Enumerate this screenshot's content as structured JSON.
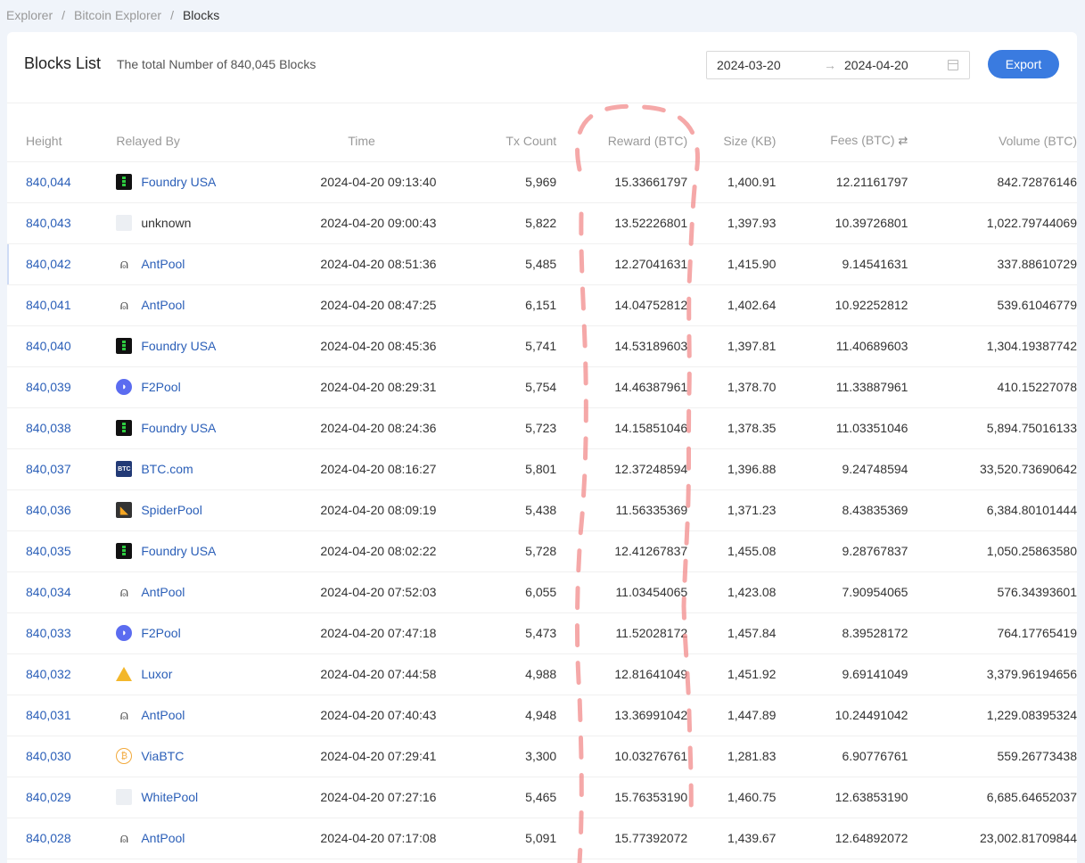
{
  "breadcrumb": [
    "Explorer",
    "Bitcoin Explorer",
    "Blocks"
  ],
  "title": "Blocks List",
  "subtitle": "The total Number of 840,045 Blocks",
  "date_range": {
    "start": "2024-03-20",
    "end": "2024-04-20"
  },
  "export_label": "Export",
  "columns": [
    "Height",
    "Relayed By",
    "Time",
    "Tx Count",
    "Reward (BTC)",
    "Size (KB)",
    "Fees (BTC)",
    "Volume (BTC)"
  ],
  "rows": [
    {
      "height": "840,044",
      "relay": "Foundry USA",
      "icon": "foundry-icon",
      "linked": true,
      "time": "2024-04-20 09:13:40",
      "tx": "5,969",
      "reward": "15.33661797",
      "size": "1,400.91",
      "fees": "12.21161797",
      "volume": "842.72876146"
    },
    {
      "height": "840,043",
      "relay": "unknown",
      "icon": "unknown-pool-icon",
      "linked": false,
      "time": "2024-04-20 09:00:43",
      "tx": "5,822",
      "reward": "13.52226801",
      "size": "1,397.93",
      "fees": "10.39726801",
      "volume": "1,022.79744069"
    },
    {
      "height": "840,042",
      "relay": "AntPool",
      "icon": "antpool-icon",
      "linked": true,
      "time": "2024-04-20 08:51:36",
      "tx": "5,485",
      "reward": "12.27041631",
      "size": "1,415.90",
      "fees": "9.14541631",
      "volume": "337.88610729"
    },
    {
      "height": "840,041",
      "relay": "AntPool",
      "icon": "antpool-icon",
      "linked": true,
      "time": "2024-04-20 08:47:25",
      "tx": "6,151",
      "reward": "14.04752812",
      "size": "1,402.64",
      "fees": "10.92252812",
      "volume": "539.61046779"
    },
    {
      "height": "840,040",
      "relay": "Foundry USA",
      "icon": "foundry-icon",
      "linked": true,
      "time": "2024-04-20 08:45:36",
      "tx": "5,741",
      "reward": "14.53189603",
      "size": "1,397.81",
      "fees": "11.40689603",
      "volume": "1,304.19387742"
    },
    {
      "height": "840,039",
      "relay": "F2Pool",
      "icon": "f2pool-icon",
      "linked": true,
      "time": "2024-04-20 08:29:31",
      "tx": "5,754",
      "reward": "14.46387961",
      "size": "1,378.70",
      "fees": "11.33887961",
      "volume": "410.15227078"
    },
    {
      "height": "840,038",
      "relay": "Foundry USA",
      "icon": "foundry-icon",
      "linked": true,
      "time": "2024-04-20 08:24:36",
      "tx": "5,723",
      "reward": "14.15851046",
      "size": "1,378.35",
      "fees": "11.03351046",
      "volume": "5,894.75016133"
    },
    {
      "height": "840,037",
      "relay": "BTC.com",
      "icon": "btccom-icon",
      "linked": true,
      "time": "2024-04-20 08:16:27",
      "tx": "5,801",
      "reward": "12.37248594",
      "size": "1,396.88",
      "fees": "9.24748594",
      "volume": "33,520.73690642"
    },
    {
      "height": "840,036",
      "relay": "SpiderPool",
      "icon": "spiderpool-icon",
      "linked": true,
      "time": "2024-04-20 08:09:19",
      "tx": "5,438",
      "reward": "11.56335369",
      "size": "1,371.23",
      "fees": "8.43835369",
      "volume": "6,384.80101444"
    },
    {
      "height": "840,035",
      "relay": "Foundry USA",
      "icon": "foundry-icon",
      "linked": true,
      "time": "2024-04-20 08:02:22",
      "tx": "5,728",
      "reward": "12.41267837",
      "size": "1,455.08",
      "fees": "9.28767837",
      "volume": "1,050.25863580"
    },
    {
      "height": "840,034",
      "relay": "AntPool",
      "icon": "antpool-icon",
      "linked": true,
      "time": "2024-04-20 07:52:03",
      "tx": "6,055",
      "reward": "11.03454065",
      "size": "1,423.08",
      "fees": "7.90954065",
      "volume": "576.34393601"
    },
    {
      "height": "840,033",
      "relay": "F2Pool",
      "icon": "f2pool-icon",
      "linked": true,
      "time": "2024-04-20 07:47:18",
      "tx": "5,473",
      "reward": "11.52028172",
      "size": "1,457.84",
      "fees": "8.39528172",
      "volume": "764.17765419"
    },
    {
      "height": "840,032",
      "relay": "Luxor",
      "icon": "luxor-icon",
      "linked": true,
      "time": "2024-04-20 07:44:58",
      "tx": "4,988",
      "reward": "12.81641049",
      "size": "1,451.92",
      "fees": "9.69141049",
      "volume": "3,379.96194656"
    },
    {
      "height": "840,031",
      "relay": "AntPool",
      "icon": "antpool-icon",
      "linked": true,
      "time": "2024-04-20 07:40:43",
      "tx": "4,948",
      "reward": "13.36991042",
      "size": "1,447.89",
      "fees": "10.24491042",
      "volume": "1,229.08395324"
    },
    {
      "height": "840,030",
      "relay": "ViaBTC",
      "icon": "viabtc-icon",
      "linked": true,
      "time": "2024-04-20 07:29:41",
      "tx": "3,300",
      "reward": "10.03276761",
      "size": "1,281.83",
      "fees": "6.90776761",
      "volume": "559.26773438"
    },
    {
      "height": "840,029",
      "relay": "WhitePool",
      "icon": "whitepool-icon",
      "linked": true,
      "time": "2024-04-20 07:27:16",
      "tx": "5,465",
      "reward": "15.76353190",
      "size": "1,460.75",
      "fees": "12.63853190",
      "volume": "6,685.64652037"
    },
    {
      "height": "840,028",
      "relay": "AntPool",
      "icon": "antpool-icon",
      "linked": true,
      "time": "2024-04-20 07:17:08",
      "tx": "5,091",
      "reward": "15.77392072",
      "size": "1,439.67",
      "fees": "12.64892072",
      "volume": "23,002.81709844"
    }
  ],
  "accent_color": "#3a7be0",
  "link_color": "#2b5fb8",
  "annotation_color": "#f28b8b"
}
